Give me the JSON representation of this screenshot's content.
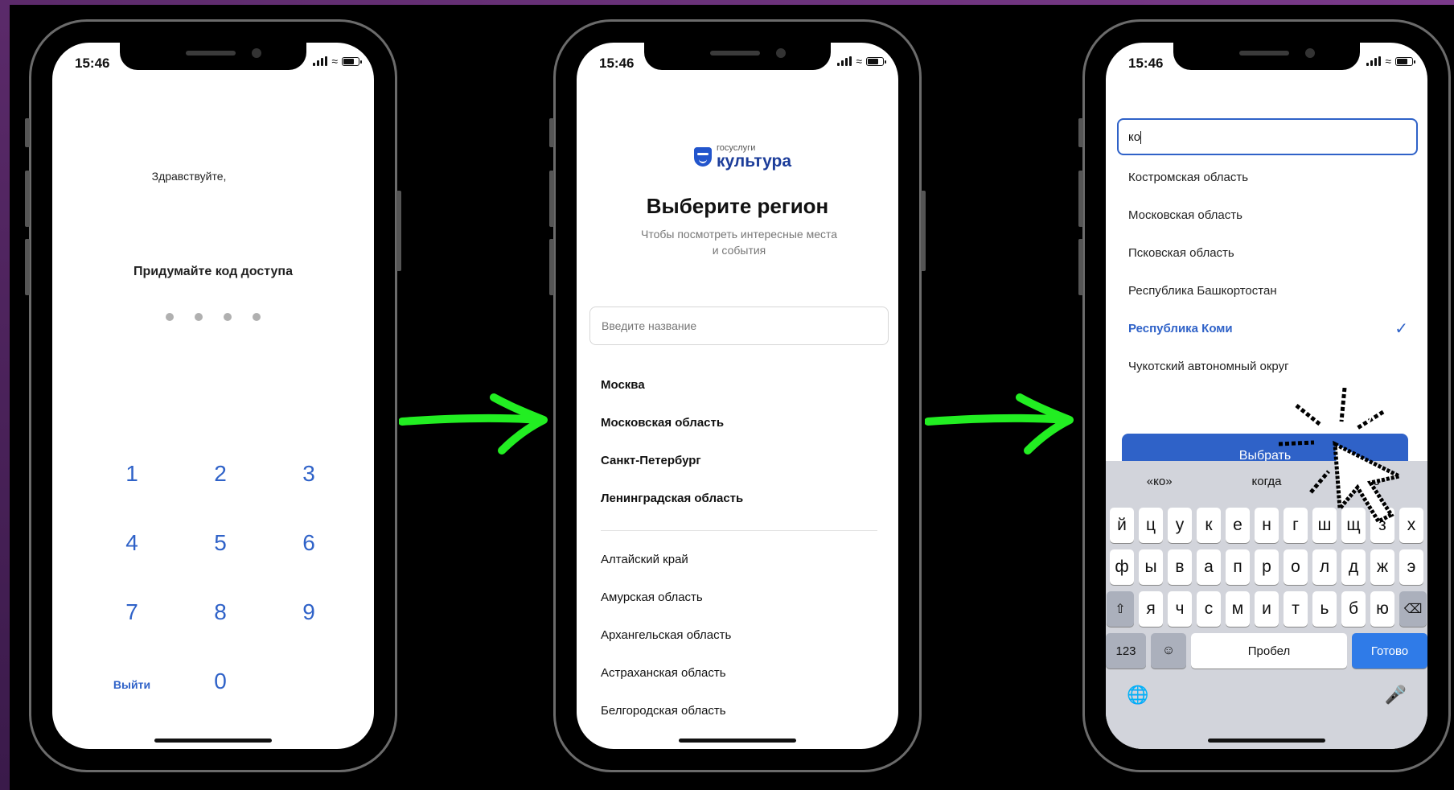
{
  "status": {
    "time": "15:46"
  },
  "phone1": {
    "greeting": "Здравствуйте,",
    "pin_title": "Придумайте код доступа",
    "keys": [
      "1",
      "2",
      "3",
      "4",
      "5",
      "6",
      "7",
      "8",
      "9",
      "Выйти",
      "0",
      ""
    ]
  },
  "phone2": {
    "logo_top": "госуслуги",
    "logo_main": "культура",
    "title": "Выберите регион",
    "subtitle": "Чтобы посмотреть интересные места и события",
    "search_placeholder": "Введите название",
    "popular": [
      "Москва",
      "Московская область",
      "Санкт-Петербург",
      "Ленинградская область"
    ],
    "regions": [
      "Алтайский край",
      "Амурская область",
      "Архангельская область",
      "Астраханская область",
      "Белгородская область"
    ]
  },
  "phone3": {
    "search_value": "ко",
    "results": [
      {
        "label": "Костромская область",
        "selected": false
      },
      {
        "label": "Московская область",
        "selected": false
      },
      {
        "label": "Псковская область",
        "selected": false
      },
      {
        "label": "Республика Башкортостан",
        "selected": false
      },
      {
        "label": "Республика Коми",
        "selected": true
      },
      {
        "label": "Чукотский автономный округ",
        "selected": false
      }
    ],
    "select_button": "Выбрать",
    "keyboard": {
      "suggestions": [
        "«ко»",
        "когда",
        "ко"
      ],
      "row1": [
        "й",
        "ц",
        "у",
        "к",
        "е",
        "н",
        "г",
        "ш",
        "щ",
        "з",
        "х"
      ],
      "row2": [
        "ф",
        "ы",
        "в",
        "а",
        "п",
        "р",
        "о",
        "л",
        "д",
        "ж",
        "э"
      ],
      "row3": [
        "я",
        "ч",
        "с",
        "м",
        "и",
        "т",
        "ь",
        "б",
        "ю"
      ],
      "num_key": "123",
      "space": "Пробел",
      "done": "Готово"
    }
  },
  "colors": {
    "accent": "#2f62c8",
    "arrow": "#22ee22"
  }
}
